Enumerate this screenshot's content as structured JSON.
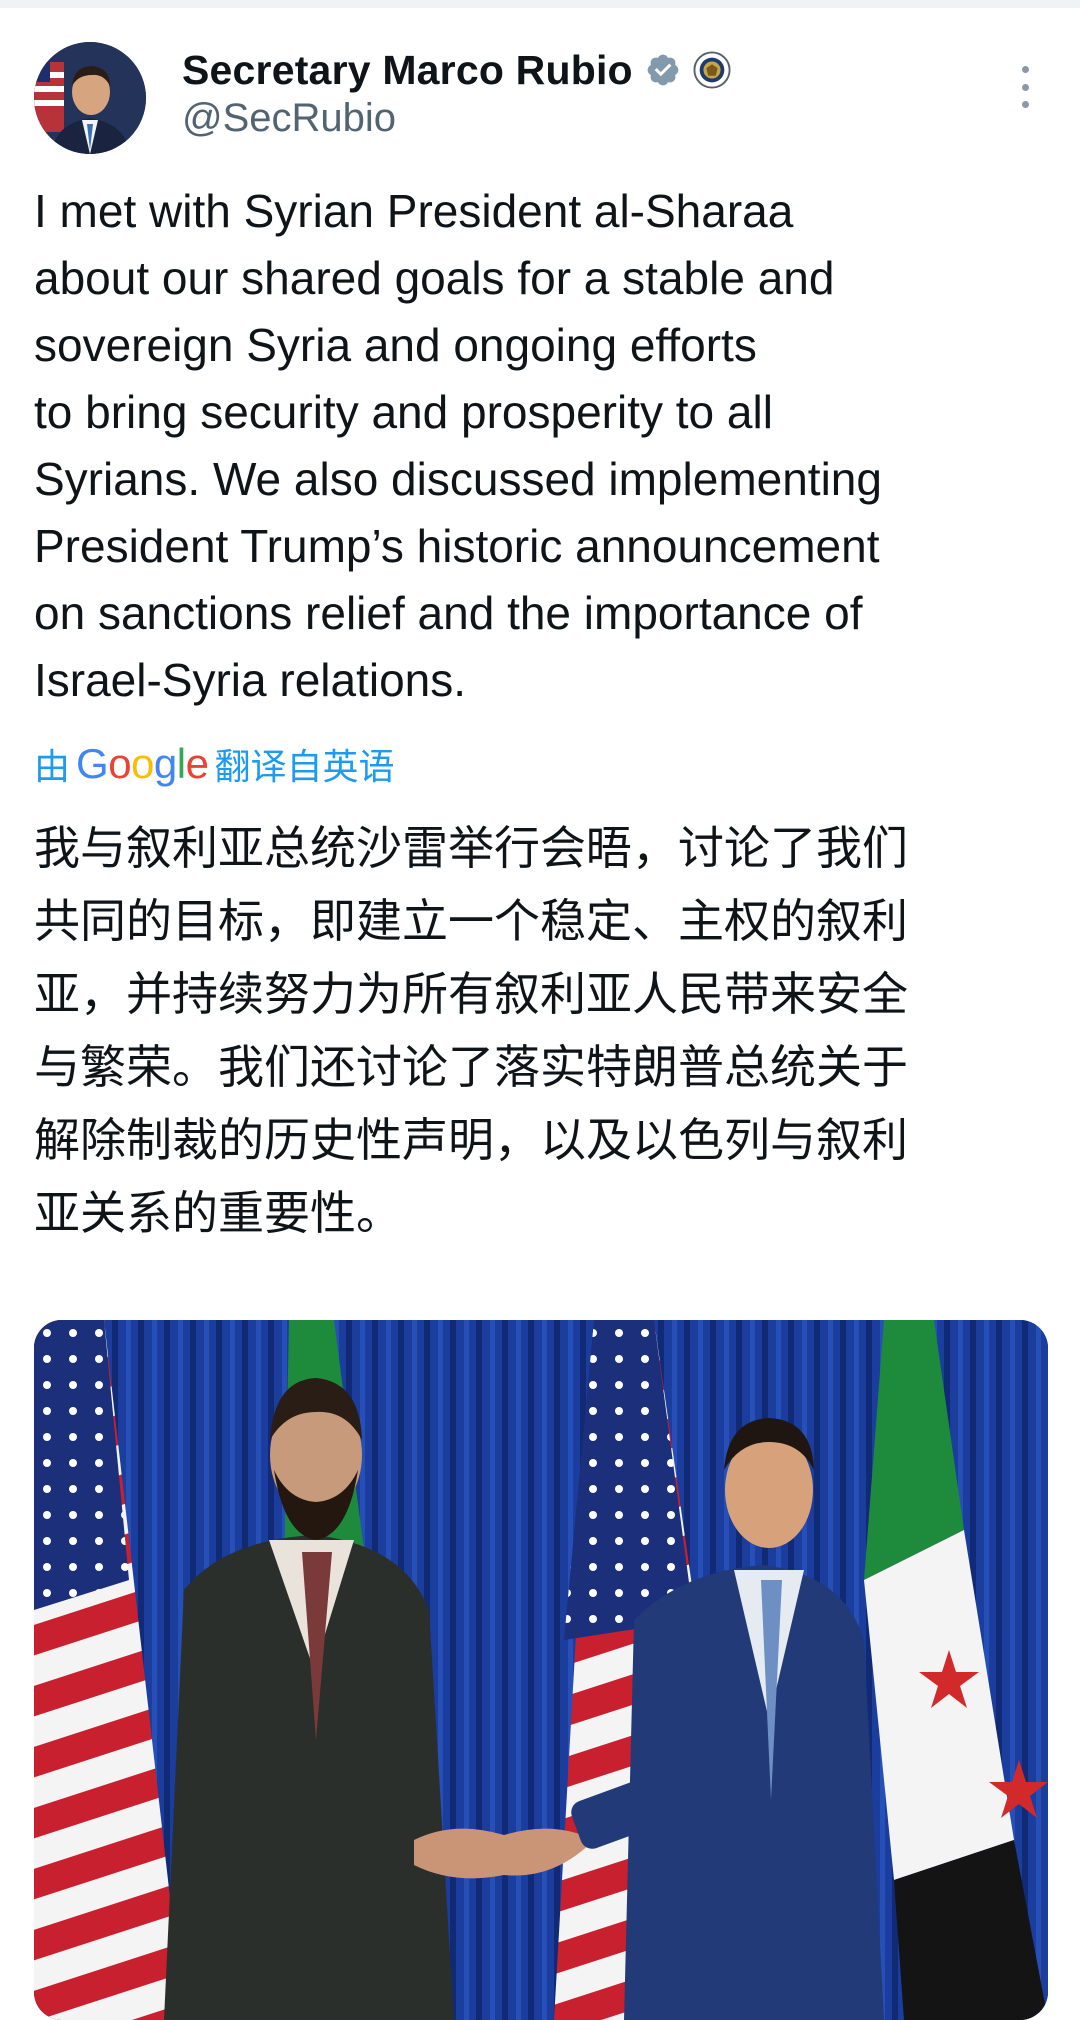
{
  "author": {
    "display_name": "Secretary Marco Rubio",
    "handle": "@SecRubio",
    "verified_icon": "verified-badge-icon",
    "affiliation_icon": "state-department-seal-icon"
  },
  "tweet": {
    "lines": [
      "I met with Syrian President al-Sharaa",
      "about our shared goals for a stable and",
      "sovereign Syria and ongoing efforts",
      "to bring security and prosperity to all",
      "Syrians. We also discussed implementing",
      "President Trump’s historic announcement",
      "on sanctions relief and the importance of",
      "Israel-Syria relations."
    ]
  },
  "translation": {
    "prefix": "由",
    "provider_letters": [
      "G",
      "o",
      "o",
      "g",
      "l",
      "e"
    ],
    "suffix": "翻译自英语",
    "lines": [
      "我与叙利亚总统沙雷举行会晤，讨论了我们",
      "共同的目标，即建立一个稳定、主权的叙利",
      "亚，并持续努力为所有叙利亚人民带来安全",
      "与繁荣。我们还讨论了落实特朗普总统关于",
      "解除制裁的历史性声明，以及以色列与叙利",
      "亚关系的重要性。"
    ]
  },
  "colors": {
    "link_blue": "#1d9bf0",
    "verified_blue": "#829aab",
    "curtain_blue": "#1a3d9e"
  }
}
